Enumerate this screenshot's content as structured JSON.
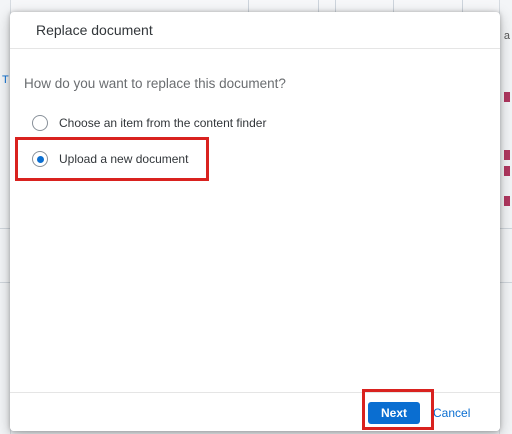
{
  "dialog": {
    "title": "Replace document",
    "question": "How do you want to replace this document?",
    "options": [
      {
        "label": "Choose an item from the content finder",
        "selected": false
      },
      {
        "label": "Upload a new document",
        "selected": true
      }
    ],
    "footer": {
      "next_label": "Next",
      "cancel_label": "Cancel"
    }
  },
  "background": {
    "left_mark": "T",
    "right_letter": "a"
  },
  "colors": {
    "accent": "#0a6ed1",
    "highlight": "#d9221f",
    "text": "#32363a",
    "muted_text": "#6a6d70"
  }
}
